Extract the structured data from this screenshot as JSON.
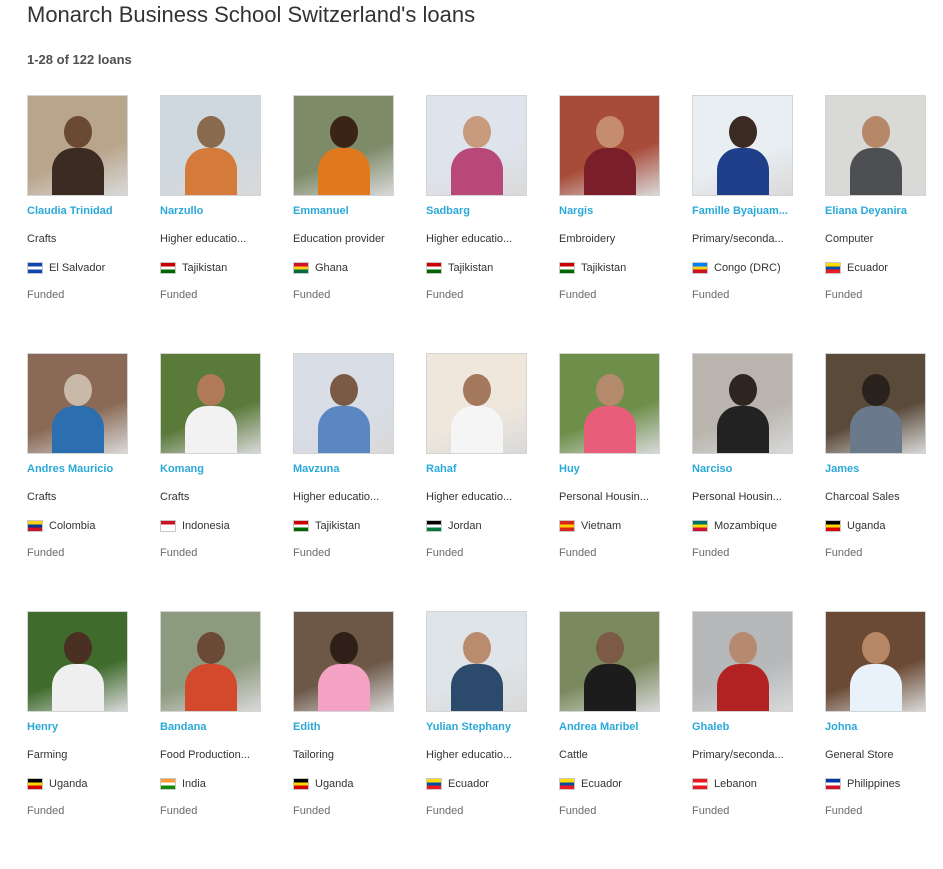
{
  "header": {
    "title": "Monarch Business School Switzerland's loans",
    "count": "1-28 of 122 loans"
  },
  "loans": [
    {
      "name": "Claudia Trinidad",
      "sector": "Crafts",
      "country": "El Salvador",
      "status": "Funded",
      "flag": [
        "#0f47af",
        "#ffffff",
        "#0f47af"
      ],
      "photo": [
        "#b9a58c",
        "#6b4a33",
        "#3c2b22"
      ]
    },
    {
      "name": "Narzullo",
      "sector": "Higher educatio...",
      "country": "Tajikistan",
      "status": "Funded",
      "flag": [
        "#cc0000",
        "#ffffff",
        "#006600"
      ],
      "photo": [
        "#cfd8de",
        "#8a6a4c",
        "#d47a3a"
      ]
    },
    {
      "name": "Emmanuel",
      "sector": "Education provider",
      "country": "Ghana",
      "status": "Funded",
      "flag": [
        "#ce1126",
        "#fcd116",
        "#006b3f"
      ],
      "photo": [
        "#7d8b68",
        "#3a2416",
        "#e0781e"
      ]
    },
    {
      "name": "Sadbarg",
      "sector": "Higher educatio...",
      "country": "Tajikistan",
      "status": "Funded",
      "flag": [
        "#cc0000",
        "#ffffff",
        "#006600"
      ],
      "photo": [
        "#dfe3ec",
        "#c89a7e",
        "#b8487a"
      ]
    },
    {
      "name": "Nargis",
      "sector": "Embroidery",
      "country": "Tajikistan",
      "status": "Funded",
      "flag": [
        "#cc0000",
        "#ffffff",
        "#006600"
      ],
      "photo": [
        "#a84c3a",
        "#c58c6e",
        "#7a1f2a"
      ]
    },
    {
      "name": "Famille Byajuam...",
      "sector": "Primary/seconda...",
      "country": "Congo (DRC)",
      "status": "Funded",
      "flag": [
        "#007fff",
        "#f7d618",
        "#ce1021"
      ],
      "photo": [
        "#e9eef2",
        "#3b2a22",
        "#1f3f8a"
      ]
    },
    {
      "name": "Eliana Deyanira",
      "sector": "Computer",
      "country": "Ecuador",
      "status": "Funded",
      "flag": [
        "#ffdd00",
        "#034ea2",
        "#ed1c24"
      ],
      "photo": [
        "#d9d9d5",
        "#b7876a",
        "#4e4f52"
      ]
    },
    {
      "name": "Andres Mauricio",
      "sector": "Crafts",
      "country": "Colombia",
      "status": "Funded",
      "flag": [
        "#fcd116",
        "#003893",
        "#ce1126"
      ],
      "photo": [
        "#8a6a56",
        "#c9b9a8",
        "#2b6fb0"
      ]
    },
    {
      "name": "Komang",
      "sector": "Crafts",
      "country": "Indonesia",
      "status": "Funded",
      "flag": [
        "#ce1126",
        "#ffffff",
        "#ffffff"
      ],
      "photo": [
        "#5a7a3a",
        "#b07a58",
        "#f2f2f2"
      ]
    },
    {
      "name": "Mavzuna",
      "sector": "Higher educatio...",
      "country": "Tajikistan",
      "status": "Funded",
      "flag": [
        "#cc0000",
        "#ffffff",
        "#006600"
      ],
      "photo": [
        "#d8dde6",
        "#7a5a44",
        "#5a86c2"
      ]
    },
    {
      "name": "Rahaf",
      "sector": "Higher educatio...",
      "country": "Jordan",
      "status": "Funded",
      "flag": [
        "#000000",
        "#ffffff",
        "#007a3d"
      ],
      "photo": [
        "#efe7dc",
        "#a4785c",
        "#f5f5f5"
      ]
    },
    {
      "name": "Huy",
      "sector": "Personal Housin...",
      "country": "Vietnam",
      "status": "Funded",
      "flag": [
        "#da251d",
        "#ffcd00",
        "#da251d"
      ],
      "photo": [
        "#6d8f4a",
        "#b58a6c",
        "#e85e7a"
      ]
    },
    {
      "name": "Narciso",
      "sector": "Personal Housin...",
      "country": "Mozambique",
      "status": "Funded",
      "flag": [
        "#007168",
        "#fce100",
        "#d21034"
      ],
      "photo": [
        "#b9b5ae",
        "#2e2520",
        "#222222"
      ]
    },
    {
      "name": "James",
      "sector": "Charcoal Sales",
      "country": "Uganda",
      "status": "Funded",
      "flag": [
        "#000000",
        "#fcdc04",
        "#d90000"
      ],
      "photo": [
        "#5a4a3a",
        "#2a221c",
        "#6a7a8c"
      ]
    },
    {
      "name": "Henry",
      "sector": "Farming",
      "country": "Uganda",
      "status": "Funded",
      "flag": [
        "#000000",
        "#fcdc04",
        "#d90000"
      ],
      "photo": [
        "#3f6b2c",
        "#4a3022",
        "#efefef"
      ]
    },
    {
      "name": "Bandana",
      "sector": "Food Production...",
      "country": "India",
      "status": "Funded",
      "flag": [
        "#ff9933",
        "#ffffff",
        "#138808"
      ],
      "photo": [
        "#8c9a7e",
        "#6a4a36",
        "#d2492c"
      ]
    },
    {
      "name": "Edith",
      "sector": "Tailoring",
      "country": "Uganda",
      "status": "Funded",
      "flag": [
        "#000000",
        "#fcdc04",
        "#d90000"
      ],
      "photo": [
        "#6d5848",
        "#2f1f18",
        "#f4a2c4"
      ]
    },
    {
      "name": "Yulian Stephany",
      "sector": "Higher educatio...",
      "country": "Ecuador",
      "status": "Funded",
      "flag": [
        "#ffdd00",
        "#034ea2",
        "#ed1c24"
      ],
      "photo": [
        "#dfe4e8",
        "#b98c6e",
        "#2c4a6c"
      ]
    },
    {
      "name": "Andrea Maribel",
      "sector": "Cattle",
      "country": "Ecuador",
      "status": "Funded",
      "flag": [
        "#ffdd00",
        "#034ea2",
        "#ed1c24"
      ],
      "photo": [
        "#7a8a5e",
        "#7c5a46",
        "#1c1c1c"
      ]
    },
    {
      "name": "Ghaleb",
      "sector": "Primary/seconda...",
      "country": "Lebanon",
      "status": "Funded",
      "flag": [
        "#ee161f",
        "#ffffff",
        "#ee161f"
      ],
      "photo": [
        "#b6b8ba",
        "#b58a6e",
        "#b22222"
      ]
    },
    {
      "name": "Johna",
      "sector": "General Store",
      "country": "Philippines",
      "status": "Funded",
      "flag": [
        "#0038a8",
        "#ffffff",
        "#ce1126"
      ],
      "photo": [
        "#6a4a34",
        "#b78766",
        "#e9f2fa"
      ]
    }
  ]
}
